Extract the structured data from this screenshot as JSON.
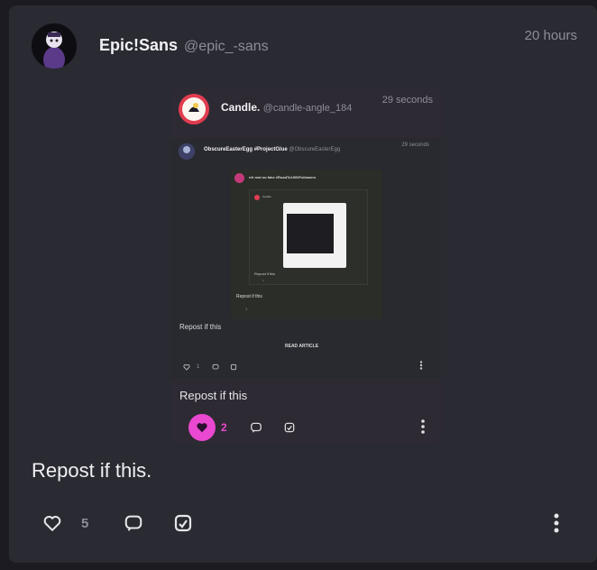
{
  "post": {
    "author_name": "Epic!Sans",
    "author_handle": "@epic_-sans",
    "time": "20 hours",
    "text": "Repost if this.",
    "like_count": "5"
  },
  "embed1": {
    "author_name": "Candle.",
    "author_handle": "@candle-angle_184",
    "time": "29 seconds",
    "text": "Repost if this",
    "like_count": "2"
  },
  "embed2": {
    "author_name": "ObscureEasterEgg #ProjectGlue",
    "author_handle": "@ObscureEasterEgg",
    "time": "29 seconds",
    "title": "READ ARTICLE",
    "text": "Repost if this",
    "like_count": "1"
  },
  "embed3": {
    "title": "nfr real no fake #RoadTo1000Followers",
    "text": "Repost if this",
    "like_count": "1"
  },
  "embed4": {
    "author_name": "Candle.",
    "text": "Repost if this",
    "like_count": "1"
  },
  "colors": {
    "accent": "#ea48d0",
    "background": "#1c1b22",
    "card": "#2a2a32"
  }
}
